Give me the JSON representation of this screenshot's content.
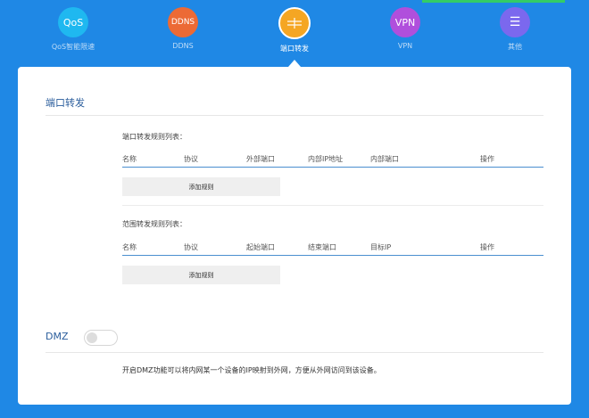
{
  "nav": {
    "items": [
      {
        "label": "QoS智能限速",
        "icon_text": "QoS",
        "icon": "qos-icon",
        "color": "#1fb8f0",
        "active": false
      },
      {
        "label": "DDNS",
        "icon_text": "DDNS",
        "icon": "ddns-icon",
        "color": "#ec6a35",
        "active": false
      },
      {
        "label": "端口转发",
        "icon_text": "",
        "icon": "port-forward-icon",
        "color": "#f5a623",
        "active": true
      },
      {
        "label": "VPN",
        "icon_text": "VPN",
        "icon": "vpn-icon",
        "color": "#b04fdc",
        "active": false
      },
      {
        "label": "其他",
        "icon_text": "☰",
        "icon": "menu-icon",
        "color": "#7b68ee",
        "active": false
      }
    ]
  },
  "port_forward": {
    "title": "端口转发",
    "list_title": "端口转发规则列表：",
    "columns": [
      "名称",
      "协议",
      "外部端口",
      "内部IP地址",
      "内部端口",
      "操作"
    ],
    "add_label": "添加规则"
  },
  "range_forward": {
    "list_title": "范围转发规则列表：",
    "columns": [
      "名称",
      "协议",
      "起始端口",
      "结束端口",
      "目标IP",
      "操作"
    ],
    "add_label": "添加规则"
  },
  "dmz": {
    "title": "DMZ",
    "enabled": false,
    "description": "开启DMZ功能可以将内网某一个设备的IP映射到外网，方便从外网访问到该设备。"
  },
  "colors": {
    "background": "#1f88e5",
    "accent": "#2a5d9c",
    "status_bar": "#33cc66"
  }
}
